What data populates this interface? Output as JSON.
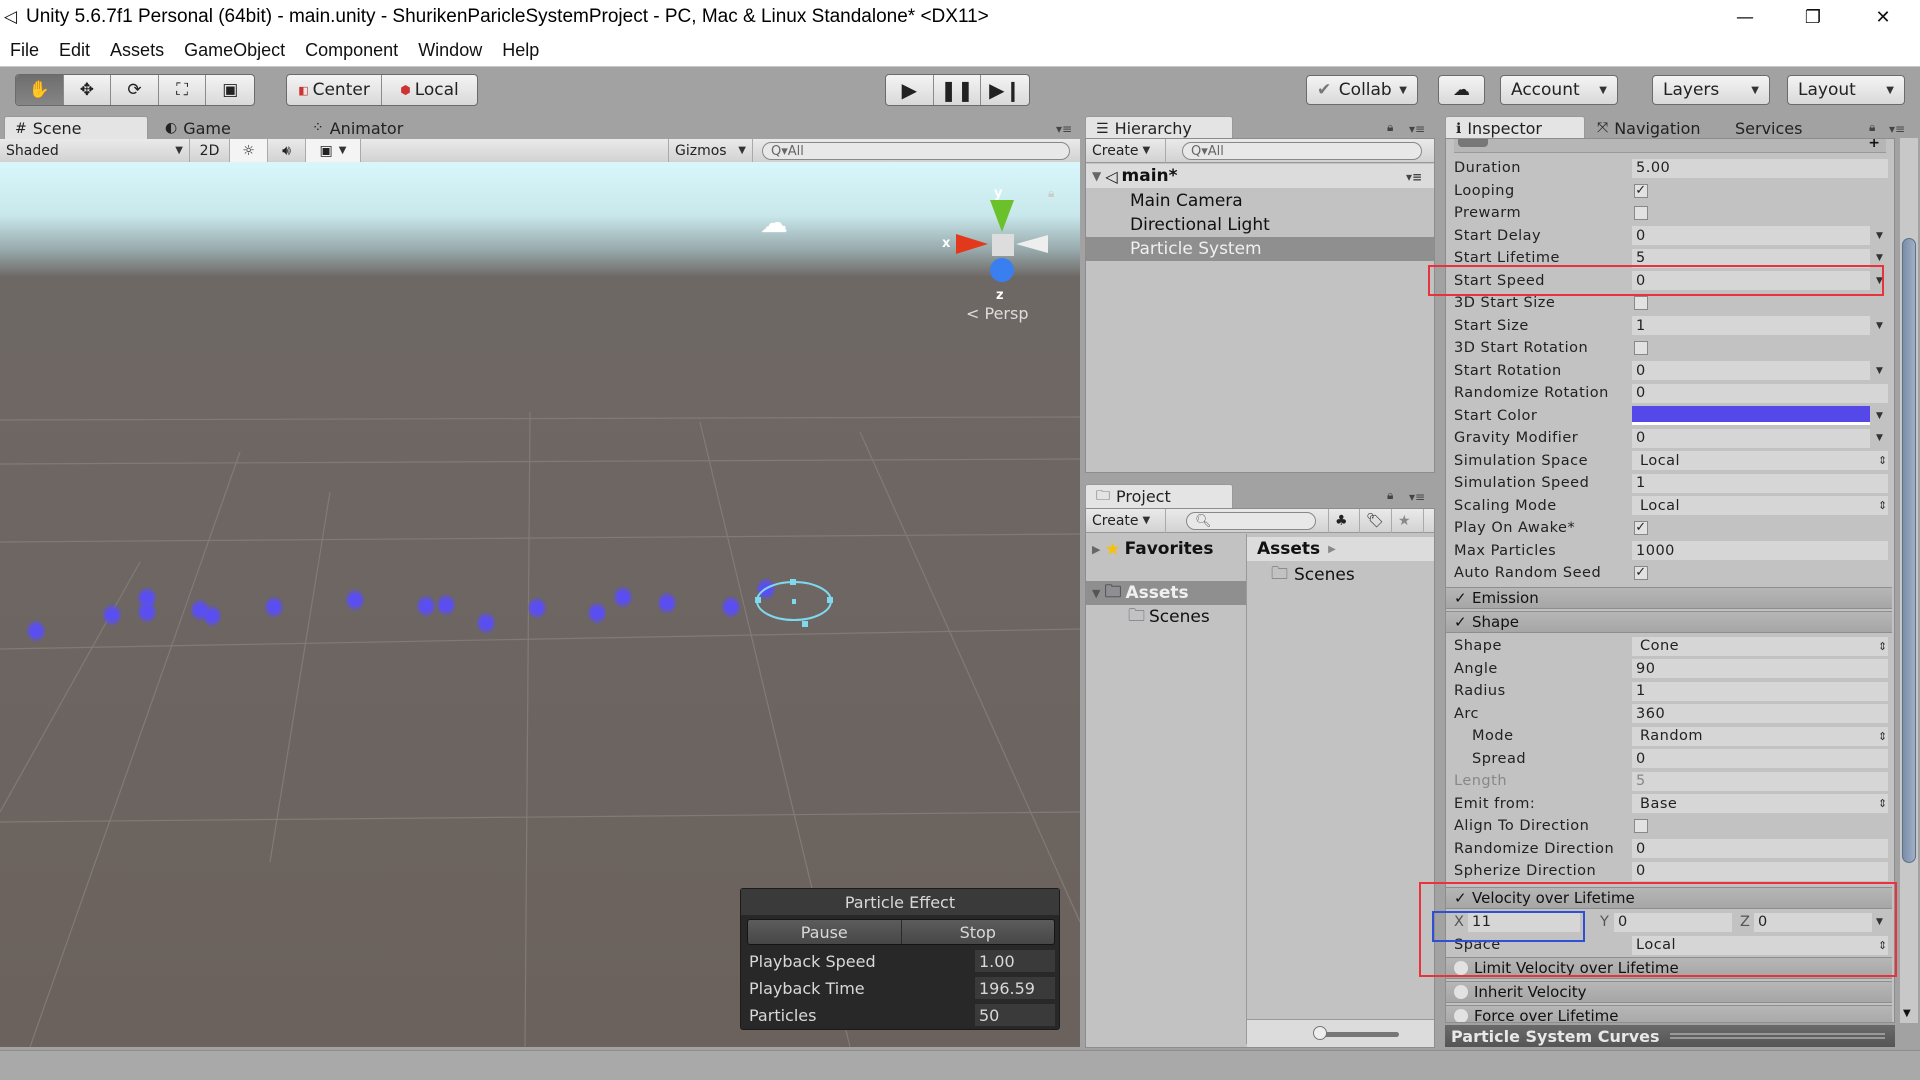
{
  "window": {
    "title": "Unity 5.6.7f1 Personal (64bit) - main.unity - ShurikenParicleSystemProject - PC, Mac & Linux Standalone* <DX11>",
    "controls": [
      "minimize",
      "restore",
      "close"
    ]
  },
  "menu": [
    "File",
    "Edit",
    "Assets",
    "GameObject",
    "Component",
    "Window",
    "Help"
  ],
  "toolbar": {
    "tools": [
      "hand-tool",
      "move-tool",
      "rotate-tool",
      "scale-tool",
      "rect-tool"
    ],
    "active_tool": "hand-tool",
    "pivot_label": "Center",
    "space_label": "Local",
    "play_controls": [
      "play",
      "pause",
      "step"
    ],
    "collab_label": "Collab",
    "account_label": "Account",
    "layers_label": "Layers",
    "layout_label": "Layout"
  },
  "scene_panel": {
    "tabs": [
      {
        "label": "Scene",
        "icon": "#",
        "selected": true
      },
      {
        "label": "Game",
        "icon": "◐",
        "selected": false
      },
      {
        "label": "Animator",
        "icon": "⁘",
        "selected": false
      }
    ],
    "draw_mode": "Shaded",
    "mode_2d": "2D",
    "gizmos_label": "Gizmos",
    "search_placeholder": "All",
    "gizmo_axes": {
      "x": "x",
      "y": "y",
      "z": "z"
    },
    "projection_label": "Persp",
    "selection_color": "#7fd8ee",
    "particle_color": "#5a4ef3"
  },
  "particle_effect": {
    "title": "Particle Effect",
    "pause_label": "Pause",
    "stop_label": "Stop",
    "rows": [
      {
        "label": "Playback Speed",
        "value": "1.00"
      },
      {
        "label": "Playback Time",
        "value": "196.59"
      },
      {
        "label": "Particles",
        "value": "50"
      }
    ]
  },
  "hierarchy": {
    "tab_label": "Hierarchy",
    "create_label": "Create",
    "search_placeholder": "All",
    "scene_name": "main*",
    "items": [
      {
        "label": "Main Camera",
        "selected": false
      },
      {
        "label": "Directional Light",
        "selected": false
      },
      {
        "label": "Particle System",
        "selected": true
      }
    ]
  },
  "project": {
    "tab_label": "Project",
    "create_label": "Create",
    "search_placeholder": "",
    "favorites_label": "Favorites",
    "tree": [
      {
        "label": "Assets",
        "selected": true,
        "expanded": true
      },
      {
        "label": "Scenes",
        "selected": false,
        "indent": 1
      }
    ],
    "breadcrumb": "Assets",
    "content": [
      "Scenes"
    ]
  },
  "inspector": {
    "tabs": [
      {
        "label": "Inspector",
        "selected": true
      },
      {
        "label": "Navigation",
        "selected": false
      },
      {
        "label": "Services",
        "selected": false
      }
    ],
    "main_props": [
      {
        "label": "Duration",
        "type": "text",
        "value": "5.00"
      },
      {
        "label": "Looping",
        "type": "check",
        "value": true
      },
      {
        "label": "Prewarm",
        "type": "check",
        "value": false
      },
      {
        "label": "Start Delay",
        "type": "curve",
        "value": "0"
      },
      {
        "label": "Start Lifetime",
        "type": "curve",
        "value": "5"
      },
      {
        "label": "Start Speed",
        "type": "curve",
        "value": "0"
      },
      {
        "label": "3D Start Size",
        "type": "check",
        "value": false
      },
      {
        "label": "Start Size",
        "type": "curve",
        "value": "1"
      },
      {
        "label": "3D Start Rotation",
        "type": "check",
        "value": false
      },
      {
        "label": "Start Rotation",
        "type": "curve",
        "value": "0"
      },
      {
        "label": "Randomize Rotation",
        "type": "text",
        "value": "0"
      },
      {
        "label": "Start Color",
        "type": "color",
        "value": "#5448e8"
      },
      {
        "label": "Gravity Modifier",
        "type": "curve",
        "value": "0"
      },
      {
        "label": "Simulation Space",
        "type": "enum",
        "value": "Local"
      },
      {
        "label": "Simulation Speed",
        "type": "text",
        "value": "1"
      },
      {
        "label": "Scaling Mode",
        "type": "enum",
        "value": "Local"
      },
      {
        "label": "Play On Awake*",
        "type": "check",
        "value": true
      },
      {
        "label": "Max Particles",
        "type": "text",
        "value": "1000"
      },
      {
        "label": "Auto Random Seed",
        "type": "check",
        "value": true
      }
    ],
    "emission_label": "Emission",
    "shape_label": "Shape",
    "shape_props": [
      {
        "label": "Shape",
        "type": "enum",
        "value": "Cone"
      },
      {
        "label": "Angle",
        "type": "text",
        "value": "90"
      },
      {
        "label": "Radius",
        "type": "text",
        "value": "1"
      },
      {
        "label": "Arc",
        "type": "text",
        "value": "360"
      },
      {
        "label": "Mode",
        "type": "enum",
        "value": "Random",
        "indent": true
      },
      {
        "label": "Spread",
        "type": "text",
        "value": "0",
        "indent": true
      },
      {
        "label": "Length",
        "type": "text",
        "value": "5",
        "disabled": true
      },
      {
        "label": "Emit from:",
        "type": "enum",
        "value": "Base"
      },
      {
        "label": "Align To Direction",
        "type": "check",
        "value": false
      },
      {
        "label": "Randomize Direction",
        "type": "text",
        "value": "0"
      },
      {
        "label": "Spherize Direction",
        "type": "text",
        "value": "0"
      }
    ],
    "velocity": {
      "label": "Velocity over Lifetime",
      "x_label": "X",
      "x": "11",
      "y_label": "Y",
      "y": "0",
      "z_label": "Z",
      "z": "0",
      "space_label": "Space",
      "space": "Local"
    },
    "disabled_modules": [
      "Limit Velocity over Lifetime",
      "Inherit Velocity",
      "Force over Lifetime"
    ],
    "curves_label": "Particle System Curves"
  }
}
